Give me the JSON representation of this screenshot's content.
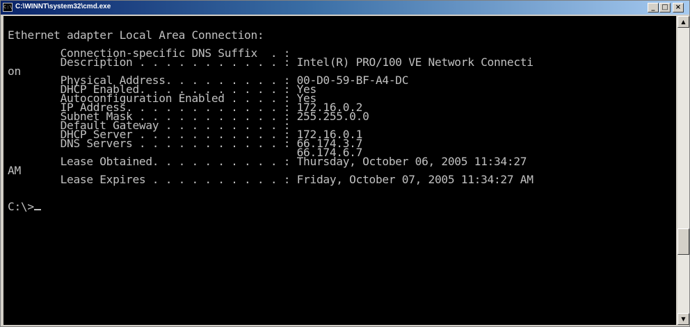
{
  "window": {
    "title": "C:\\WINNT\\system32\\cmd.exe",
    "icon_label": "C:\\"
  },
  "controls": {
    "minimize": "_",
    "maximize": "□",
    "close": "×"
  },
  "scrollbar": {
    "up_arrow": "▲",
    "down_arrow": "▼"
  },
  "console": {
    "lines": [
      "",
      "Ethernet adapter Local Area Connection:",
      "",
      "        Connection-specific DNS Suffix  . :",
      "        Description . . . . . . . . . . . : Intel(R) PRO/100 VE Network Connecti",
      "on",
      "        Physical Address. . . . . . . . . : 00-D0-59-BF-A4-DC",
      "        DHCP Enabled. . . . . . . . . . . : Yes",
      "        Autoconfiguration Enabled . . . . : Yes",
      "        IP Address. . . . . . . . . . . . : 172.16.0.2",
      "        Subnet Mask . . . . . . . . . . . : 255.255.0.0",
      "        Default Gateway . . . . . . . . . :",
      "        DHCP Server . . . . . . . . . . . : 172.16.0.1",
      "        DNS Servers . . . . . . . . . . . : 66.174.3.7",
      "                                            66.174.6.7",
      "        Lease Obtained. . . . . . . . . . : Thursday, October 06, 2005 11:34:27",
      "AM",
      "        Lease Expires . . . . . . . . . . : Friday, October 07, 2005 11:34:27 AM",
      "",
      "",
      "C:\\>"
    ]
  }
}
